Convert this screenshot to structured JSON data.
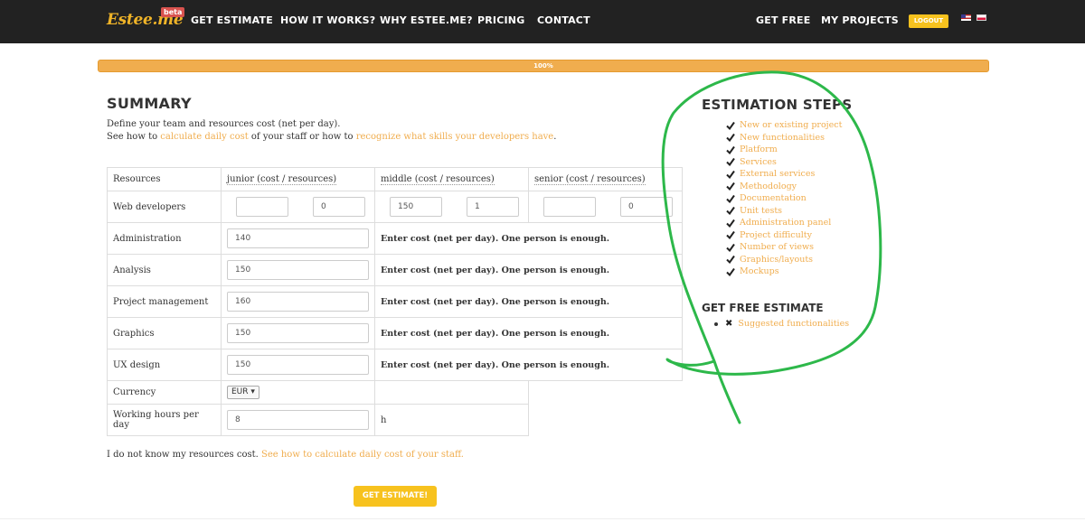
{
  "nav": {
    "logo": "Estee.me",
    "beta": "beta",
    "items": [
      "GET ESTIMATE",
      "HOW IT WORKS?",
      "WHY ESTEE.ME?",
      "PRICING",
      "CONTACT"
    ],
    "right": [
      "GET FREE",
      "MY PROJECTS"
    ],
    "logout": "LOGOUT",
    "flags": [
      "english-flag-icon",
      "polish-flag-icon"
    ]
  },
  "progress": {
    "value": 1.0,
    "label": "100%"
  },
  "summary": {
    "title": "SUMMARY",
    "line1": "Define your team and resources cost (net per day).",
    "line2_pre": "See how to ",
    "line2_link1": "calculate daily cost",
    "line2_mid": " of your staff or how to ",
    "line2_link2": "recognize what skills your developers have",
    "line2_post": "."
  },
  "table": {
    "headers": [
      "Resources",
      "junior (cost / resources)",
      "middle (cost / resources)",
      "senior (cost / resources)"
    ],
    "web_dev": {
      "label": "Web developers",
      "junior": [
        "",
        "0"
      ],
      "middle": [
        "150",
        "1"
      ],
      "senior": [
        "",
        "0"
      ]
    },
    "rows": [
      {
        "label": "Administration",
        "value": "140",
        "note": "Enter cost (net per day). One person is enough."
      },
      {
        "label": "Analysis",
        "value": "150",
        "note": "Enter cost (net per day). One person is enough."
      },
      {
        "label": "Project management",
        "value": "160",
        "note": "Enter cost (net per day). One person is enough."
      },
      {
        "label": "Graphics",
        "value": "150",
        "note": "Enter cost (net per day). One person is enough."
      },
      {
        "label": "UX design",
        "value": "150",
        "note": "Enter cost (net per day). One person is enough."
      }
    ],
    "currency": {
      "label": "Currency",
      "value": "EUR"
    },
    "hours": {
      "label": "Working hours per day",
      "value": "8",
      "unit": "h"
    }
  },
  "footer": {
    "text_pre": "I do not know my resources cost. ",
    "link": "See how to calculate daily cost of your staff."
  },
  "cta": "GET ESTIMATE!",
  "steps": {
    "title": "ESTIMATION STEPS",
    "items": [
      "New or existing project",
      "New functionalities",
      "Platform",
      "Services",
      "External services",
      "Methodology",
      "Documentation",
      "Unit tests",
      "Administration panel",
      "Project difficulty",
      "Number of views",
      "Graphics/layouts",
      "Mockups"
    ]
  },
  "free": {
    "title": "GET FREE ESTIMATE",
    "items": [
      "Suggested functionalities"
    ]
  },
  "colors": {
    "accent": "#f0ad4e",
    "button": "#f7c21e",
    "topbar": "#222222",
    "annotation": "#2db84a"
  }
}
